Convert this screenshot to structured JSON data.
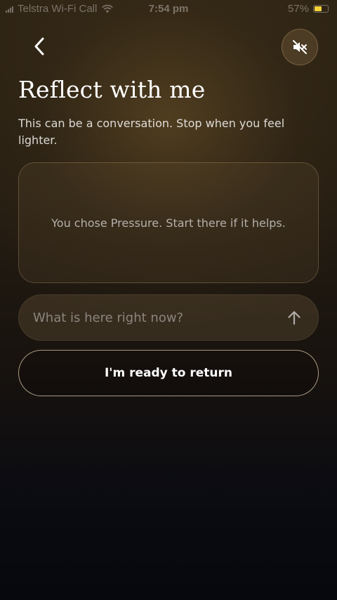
{
  "status_bar": {
    "carrier": "Telstra Wi-Fi Call",
    "time": "7:54 pm",
    "battery": "57%",
    "battery_level": 0.57,
    "signal_icon": "signal-bars-icon",
    "wifi_icon": "wifi-icon",
    "battery_icon": "battery-icon",
    "battery_color": "#f5d33a"
  },
  "header": {
    "back_icon": "chevron-left-icon",
    "mute_icon": "speaker-muted-icon"
  },
  "main": {
    "title": "Reflect with me",
    "subtitle": "This can be a conversation. Stop when you feel lighter.",
    "prompt": "You chose Pressure. Start there if it helps.",
    "input": {
      "value": "",
      "placeholder": "What is here right now?",
      "send_icon": "arrow-up-icon"
    },
    "ready_button_label": "I'm ready to return"
  },
  "colors": {
    "background_top": "#2e2414",
    "background_bottom": "#06080e",
    "text_primary": "#ffffff"
  }
}
